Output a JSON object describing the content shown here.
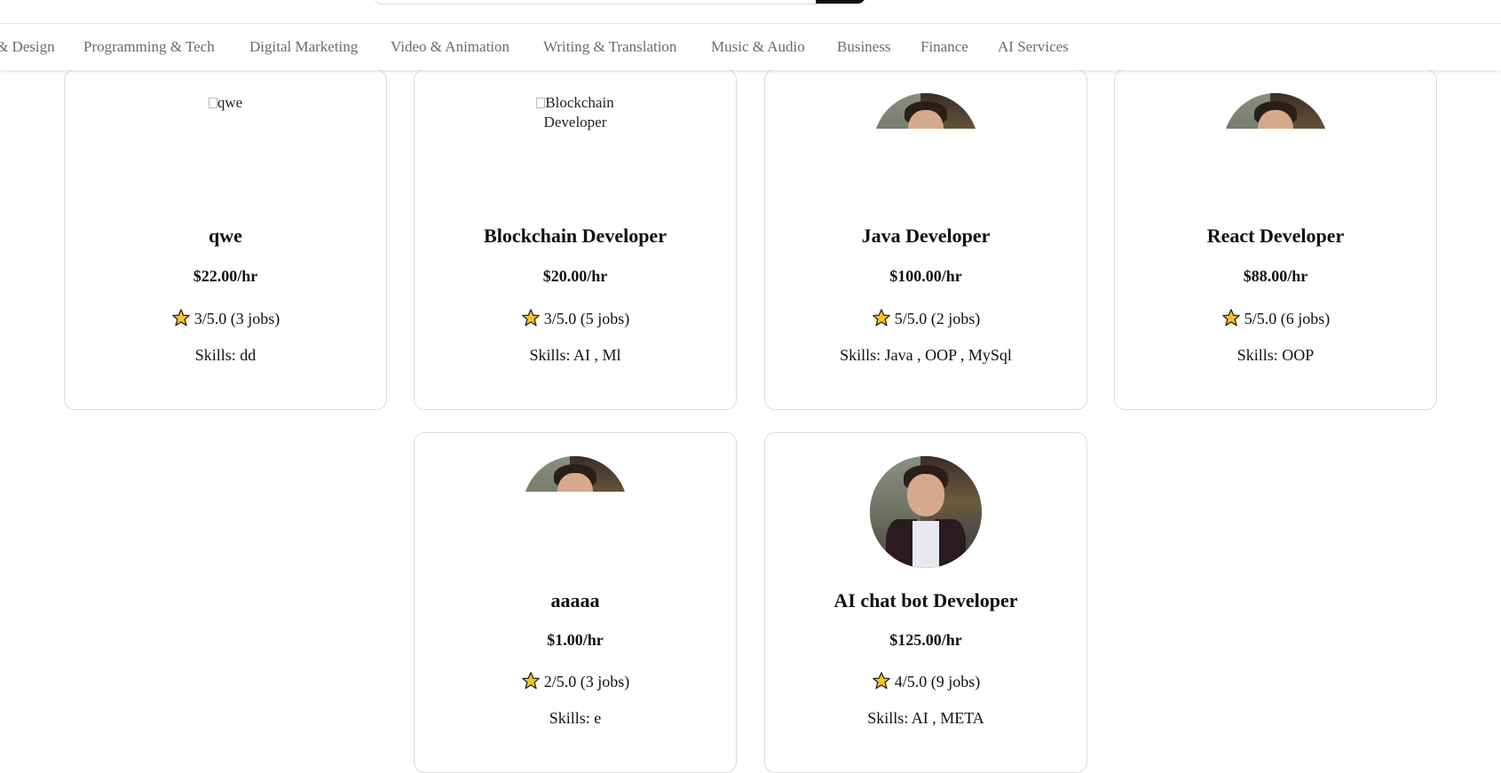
{
  "nav": {
    "categories": [
      "& Design",
      "Programming & Tech",
      "Digital Marketing",
      "Video & Animation",
      "Writing & Translation",
      "Music & Audio",
      "Business",
      "Finance",
      "AI Services"
    ]
  },
  "cards": [
    {
      "image": "broken",
      "image_alt": "qwe",
      "title": "qwe",
      "rate": "$22.00/hr",
      "rating": "3/5.0 (3 jobs)",
      "skills": "Skills: dd"
    },
    {
      "image": "broken",
      "image_alt": "Blockchain Developer",
      "title": "Blockchain Developer",
      "rate": "$20.00/hr",
      "rating": "3/5.0 (5 jobs)",
      "skills": "Skills: AI , Ml"
    },
    {
      "image": "avatar-clipped",
      "title": "Java Developer",
      "rate": "$100.00/hr",
      "rating": "5/5.0 (2 jobs)",
      "skills": "Skills: Java , OOP , MySql"
    },
    {
      "image": "avatar-clipped",
      "title": "React Developer",
      "rate": "$88.00/hr",
      "rating": "5/5.0 (6 jobs)",
      "skills": "Skills: OOP"
    },
    {
      "image": "avatar-clipped",
      "title": "aaaaa",
      "rate": "$1.00/hr",
      "rating": "2/5.0 (3 jobs)",
      "skills": "Skills: e"
    },
    {
      "image": "avatar-full",
      "title": "AI chat bot Developer",
      "rate": "$125.00/hr",
      "rating": "4/5.0 (9 jobs)",
      "skills": "Skills: AI , META"
    }
  ],
  "colors": {
    "star_fill": "#f7c325",
    "star_stroke": "#222222",
    "nav_text": "#6b6b6b",
    "card_border": "#dcdcdc"
  },
  "icons": {
    "rating": "star-icon",
    "broken_image": "broken-image-icon"
  }
}
